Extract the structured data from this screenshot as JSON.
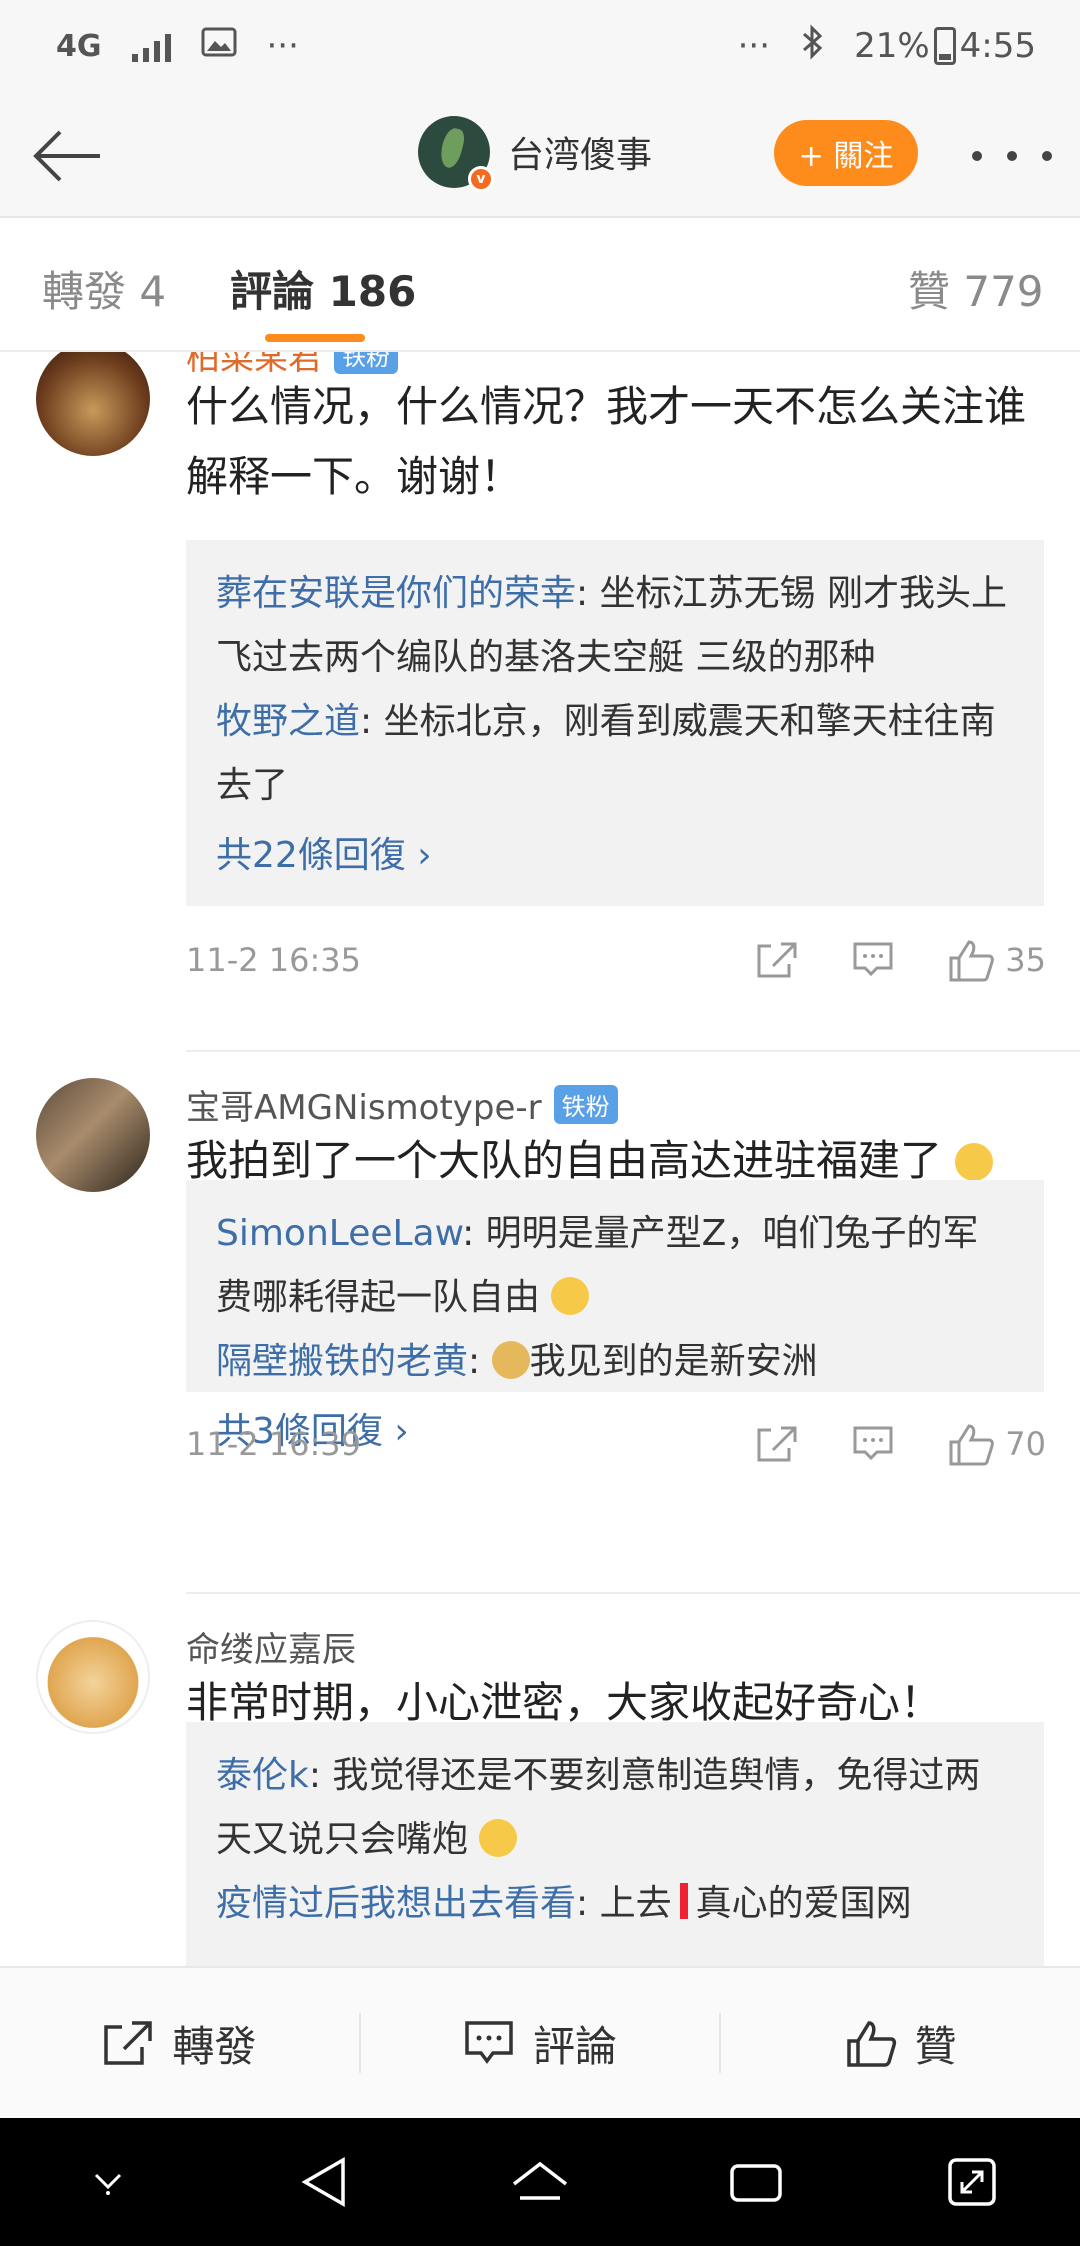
{
  "status_bar": {
    "network": "4G",
    "more": "···",
    "battery": "21%",
    "time": "4:55"
  },
  "header": {
    "account_name": "台湾傻事",
    "follow_label": "+ 關注"
  },
  "tabs": {
    "reposts": "轉發 4",
    "comments": "評論 186",
    "likes": "贊 779"
  },
  "comments": [
    {
      "user": "柏菜某君",
      "badge": "铁粉",
      "text": "什么情况，什么情况？我才一天不怎么关注谁解释一下。谢谢！",
      "replies": [
        {
          "name": "葬在安联是你们的荣幸",
          "text": ": 坐标江苏无锡 刚才我头上飞过去两个编队的基洛夫空艇 三级的那种"
        },
        {
          "name": "牧野之道",
          "text": ": 坐标北京，刚看到威震天和擎天柱往南去了"
        }
      ],
      "more_replies": "共22條回復 ›",
      "time": "11-2 16:35",
      "likes": "35"
    },
    {
      "user": "宝哥AMGNismotype-r",
      "badge": "铁粉",
      "text": "我拍到了一个大队的自由高达进驻福建了",
      "replies": [
        {
          "name": "SimonLeeLaw",
          "text": ": 明明是量产型Z，咱们兔子的军费哪耗得起一队自由"
        },
        {
          "name": "隔壁搬铁的老黄",
          "text": "我见到的是新安洲"
        }
      ],
      "more_replies": "共3條回復 ›",
      "time": "11-2 16:39",
      "likes": "70"
    },
    {
      "user": "命缕应嘉辰",
      "text": "非常时期，小心泄密，大家收起好奇心！",
      "replies": [
        {
          "name": "泰伦k",
          "text": ": 我觉得还是不要刻意制造舆情，免得过两天又说只会嘴炮"
        },
        {
          "name": "疫情过后我想出去看看",
          "text": ": 上去",
          "text2": "真心的爱国网"
        }
      ]
    }
  ],
  "bottom_bar": {
    "repost": "轉發",
    "comment": "評論",
    "like": "贊"
  },
  "colors": {
    "accent_orange": "#fd8c1d",
    "link_blue": "#3e6ea8",
    "fan_badge": "#5aa0e6"
  }
}
